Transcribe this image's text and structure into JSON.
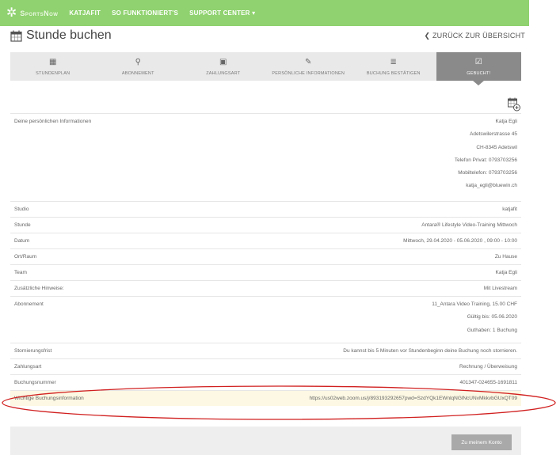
{
  "nav": {
    "brand": "SportsNow",
    "links": [
      "KATJAFIT",
      "SO FUNKTIONIERT'S",
      "SUPPORT CENTER ▾"
    ]
  },
  "header": {
    "title": "Stunde buchen",
    "back": "❮ ZURÜCK ZUR ÜBERSICHT"
  },
  "steps": [
    {
      "icon": "▦",
      "label": "STUNDENPLAN"
    },
    {
      "icon": "⚲",
      "label": "ABONNEMENT"
    },
    {
      "icon": "▣",
      "label": "ZAHLUNGSART"
    },
    {
      "icon": "✎",
      "label": "PERSÖNLICHE INFORMATIONEN"
    },
    {
      "icon": "≣",
      "label": "BUCHUNG BESTÄTIGEN"
    },
    {
      "icon": "☑",
      "label": "GEBUCHT!"
    }
  ],
  "info": {
    "personal_label": "Deine persönlichen Informationen",
    "personal_lines": [
      "Katja Egli",
      "Adetswilerstrasse 45",
      "CH-8345 Adetswil",
      "Telefon Privat: 0793703256",
      "Mobiltelefon: 0793703256",
      "katja_egli@bluewin.ch"
    ],
    "studio_label": "Studio",
    "studio": "katjafit",
    "stunde_label": "Stunde",
    "stunde": "Antara® Lifestyle Video-Training Mittwoch",
    "datum_label": "Datum",
    "datum": "Mittwoch, 29.04.2020 - 05.06.2020 , 09:00 - 10:00",
    "ort_label": "Ort/Raum",
    "ort": "Zu Hause",
    "team_label": "Team",
    "team": "Katja Egli",
    "hinweise_label": "Zusätzliche Hinweise:",
    "hinweise": "Mit Livestream",
    "abo_label": "Abonnement",
    "abo_lines": [
      "11_Antara Video Training, 15.00 CHF",
      "Gültig bis: 05.06.2020",
      "Guthaben: 1 Buchung"
    ],
    "storno_label": "Stornierungsfrist",
    "storno": "Du kannst bis 5 Minuten vor Stundenbeginn deine Buchung noch stornieren.",
    "zahlung_label": "Zahlungsart",
    "zahlung": "Rechnung / Überweisung",
    "nummer_label": "Buchungsnummer",
    "nummer": "401347-024655-1691811",
    "wichtig_label": "Wichtige Buchungsinformation",
    "wichtig": "https://us02web.zoom.us/j/893193292657pwd=SzdYQk1EWnlqNGlNcUNvMkkvbGUxQT09"
  },
  "footer": {
    "button": "Zu meinem Konto"
  },
  "colors": {
    "nav_green": "#8fd26f",
    "active_step": "#8a8a8a",
    "highlight": "#fcf8e3",
    "annotation": "#d11f1f"
  }
}
